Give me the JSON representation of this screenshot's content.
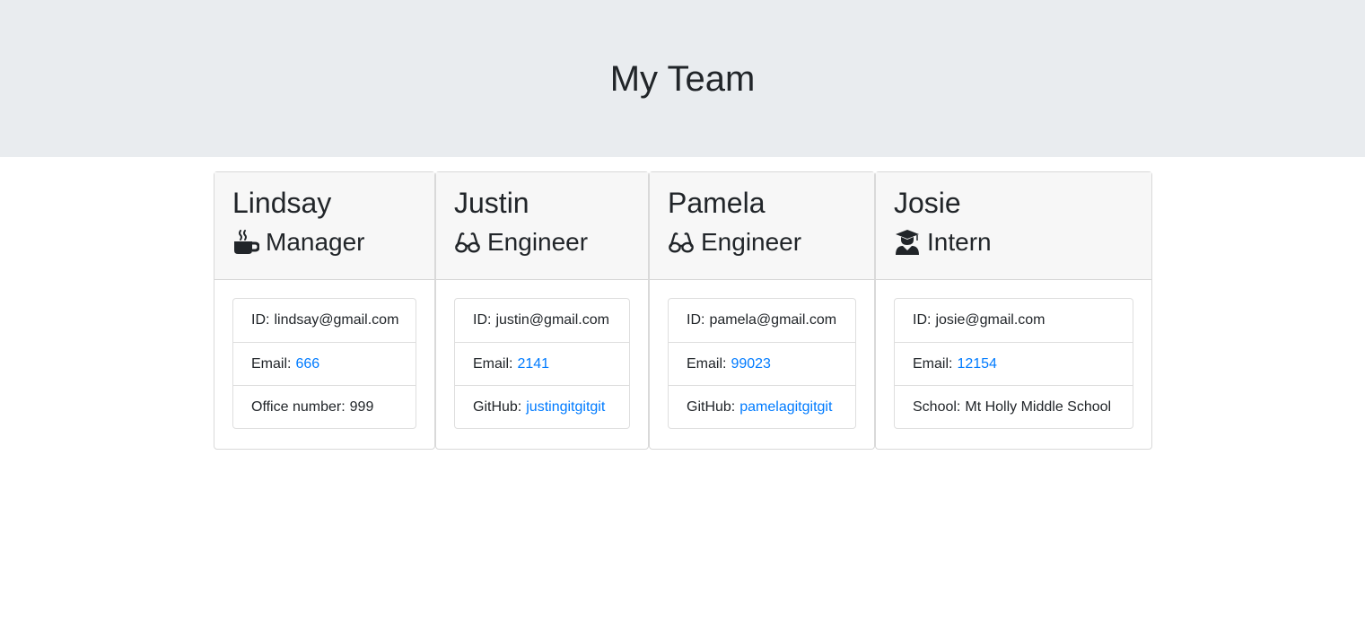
{
  "header": {
    "title": "My Team"
  },
  "colors": {
    "link": "#007bff",
    "jumbotron_bg": "#e9ecef",
    "card_header_bg": "#f7f7f7"
  },
  "team": [
    {
      "name": "Lindsay",
      "role": "Manager",
      "role_icon": "coffee-icon",
      "id_label": "ID:",
      "id_value": "lindsay@gmail.com",
      "email_label": "Email:",
      "email_value": "666",
      "extra_label": "Office number:",
      "extra_value": "999"
    },
    {
      "name": "Justin",
      "role": "Engineer",
      "role_icon": "glasses-icon",
      "id_label": "ID:",
      "id_value": "justin@gmail.com",
      "email_label": "Email:",
      "email_value": "2141",
      "extra_label": "GitHub:",
      "extra_value": "justingitgitgit"
    },
    {
      "name": "Pamela",
      "role": "Engineer",
      "role_icon": "glasses-icon",
      "id_label": "ID:",
      "id_value": "pamela@gmail.com",
      "email_label": "Email:",
      "email_value": "99023",
      "extra_label": "GitHub:",
      "extra_value": "pamelagitgitgit"
    },
    {
      "name": "Josie",
      "role": "Intern",
      "role_icon": "graduate-icon",
      "id_label": "ID:",
      "id_value": "josie@gmail.com",
      "email_label": "Email:",
      "email_value": "12154",
      "extra_label": "School:",
      "extra_value": "Mt Holly Middle School"
    }
  ]
}
